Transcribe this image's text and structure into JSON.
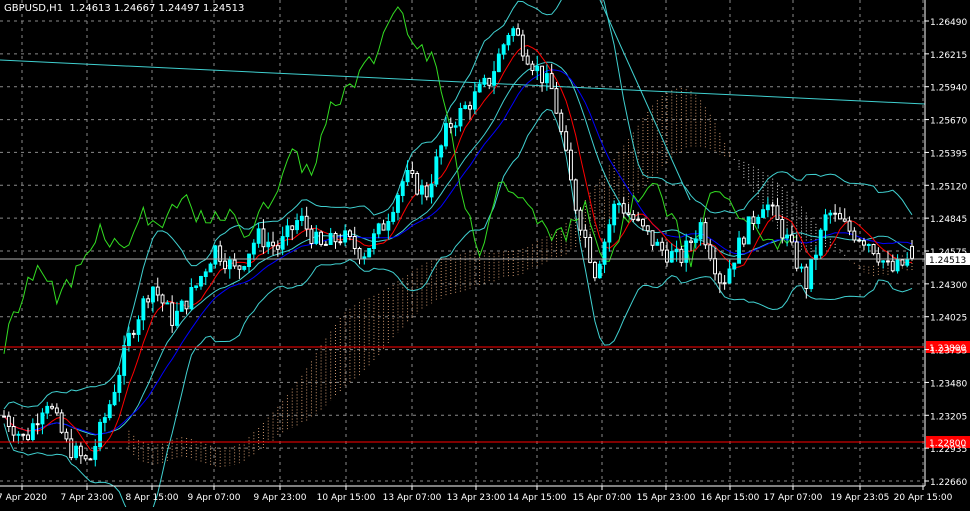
{
  "header": {
    "symbol_line": "GBPUSD,H1  1.24613 1.24667 1.24497 1.24513"
  },
  "colors": {
    "background": "#000000",
    "grid": "#8a8a8a",
    "axis_text": "#ffffff",
    "bull": "#00ffff",
    "bear": "#ffffff",
    "cloud_up": "#f0b080",
    "cloud_dn": "#ffffff",
    "tenkan": "#ff0000",
    "kijun": "#0000ff",
    "chikou": "#33dd22",
    "bands": "#40d0d0",
    "trendline": "#40d0d0",
    "level_line": "#ff0000",
    "current_price_bg": "#ffffff"
  },
  "chart_data": {
    "type": "candlestick",
    "symbol": "GBPUSD",
    "timeframe": "H1",
    "ohlc_header": {
      "open": 1.24613,
      "high": 1.24667,
      "low": 1.24497,
      "close": 1.24513
    },
    "y_ticks": [
      "1.26490",
      "1.26215",
      "1.25940",
      "1.25670",
      "1.25395",
      "1.25120",
      "1.24845",
      "1.24575",
      "1.24300",
      "1.24025",
      "1.23755",
      "1.23480",
      "1.23205",
      "1.22935",
      "1.22660"
    ],
    "ylim": [
      1.2266,
      1.2649
    ],
    "x_ticks": [
      "7 Apr 2020",
      "7 Apr 23:00",
      "8 Apr 15:00",
      "9 Apr 07:00",
      "9 Apr 23:00",
      "10 Apr 15:00",
      "13 Apr 07:00",
      "13 Apr 23:00",
      "14 Apr 15:00",
      "15 Apr 07:00",
      "15 Apr 23:00",
      "16 Apr 15:00",
      "17 Apr 07:00",
      "19 Apr 23:05",
      "20 Apr 15:00"
    ],
    "current_price": "1.24513",
    "horizontal_levels": [
      "1.23800",
      "1.22800"
    ],
    "price_path": [
      1.232,
      1.23,
      1.2335,
      1.2295,
      1.228,
      1.233,
      1.239,
      1.243,
      1.24,
      1.2425,
      1.246,
      1.244,
      1.247,
      1.246,
      1.2485,
      1.246,
      1.247,
      1.2455,
      1.248,
      1.252,
      1.2505,
      1.256,
      1.258,
      1.26,
      1.2645,
      1.2615,
      1.259,
      1.25,
      1.244,
      1.25,
      1.248,
      1.246,
      1.245,
      1.248,
      1.243,
      1.247,
      1.25,
      1.247,
      1.243,
      1.249,
      1.2475,
      1.2465,
      1.244,
      1.2451
    ]
  }
}
